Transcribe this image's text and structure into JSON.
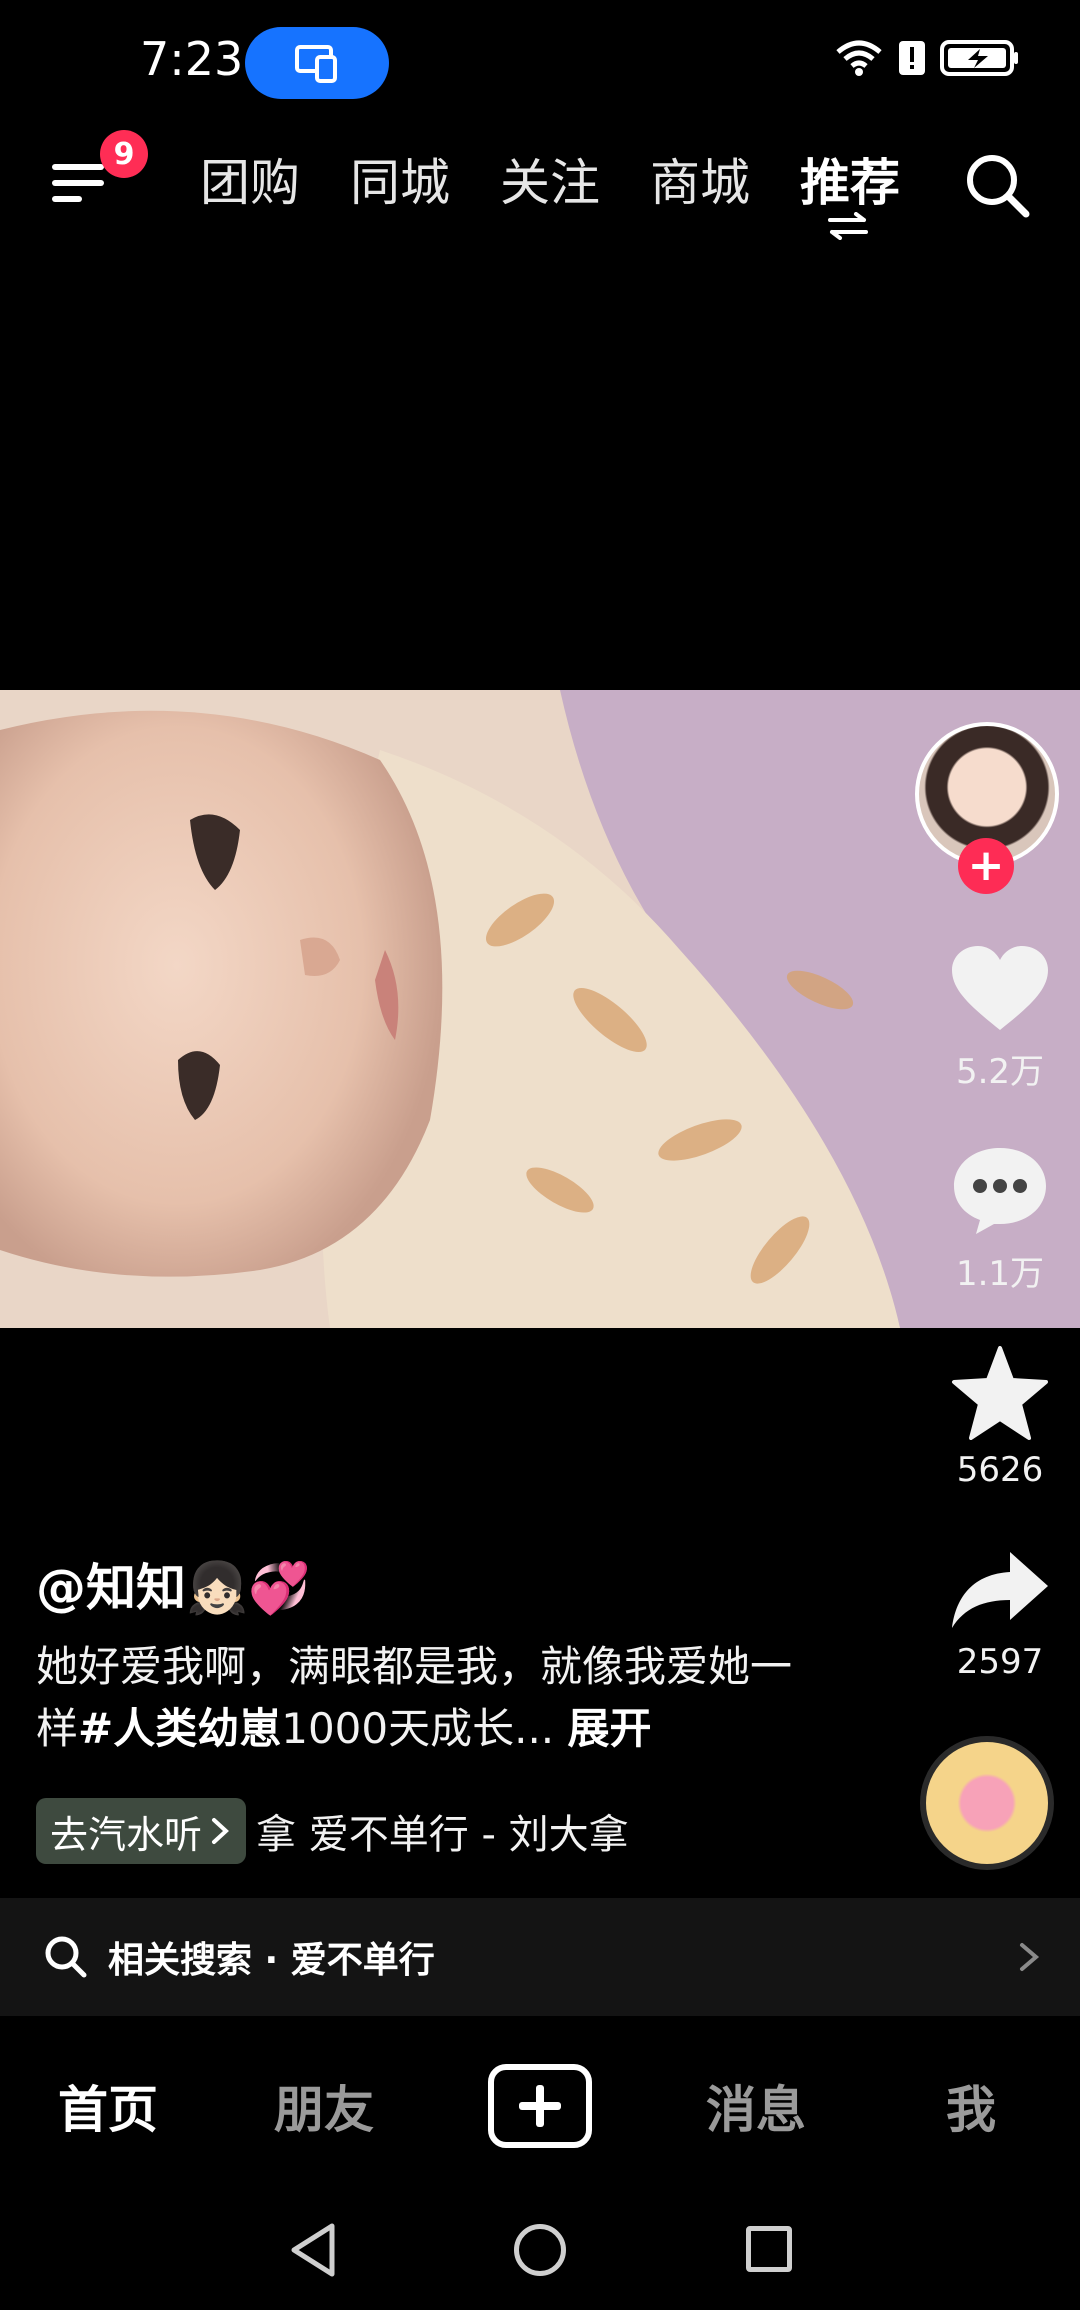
{
  "status_bar": {
    "time": "7:23"
  },
  "top_nav": {
    "menu_badge": "9",
    "tabs": [
      "团购",
      "同城",
      "关注",
      "商城",
      "推荐"
    ],
    "active_tab": "推荐"
  },
  "video": {
    "author": "@知知👧🏻💞",
    "caption_plain": "她好爱我啊，满眼都是我，就像我爱她一样",
    "caption_tag": "#人类幼崽",
    "caption_tail": "1000天成长...",
    "expand_label": "展开"
  },
  "actions": {
    "likes": "5.2万",
    "comments": "1.1万",
    "favorites": "5626",
    "shares": "2597"
  },
  "music": {
    "qishui_label": "去汽水听",
    "title": "拿    爱不单行 - 刘大拿"
  },
  "related_search": {
    "text": "相关搜索 · 爱不单行"
  },
  "bottom_nav": {
    "home": "首页",
    "friends": "朋友",
    "messages": "消息",
    "me": "我"
  },
  "colors": {
    "accent_red": "#fe2c55",
    "cast_blue": "#1673ff"
  }
}
